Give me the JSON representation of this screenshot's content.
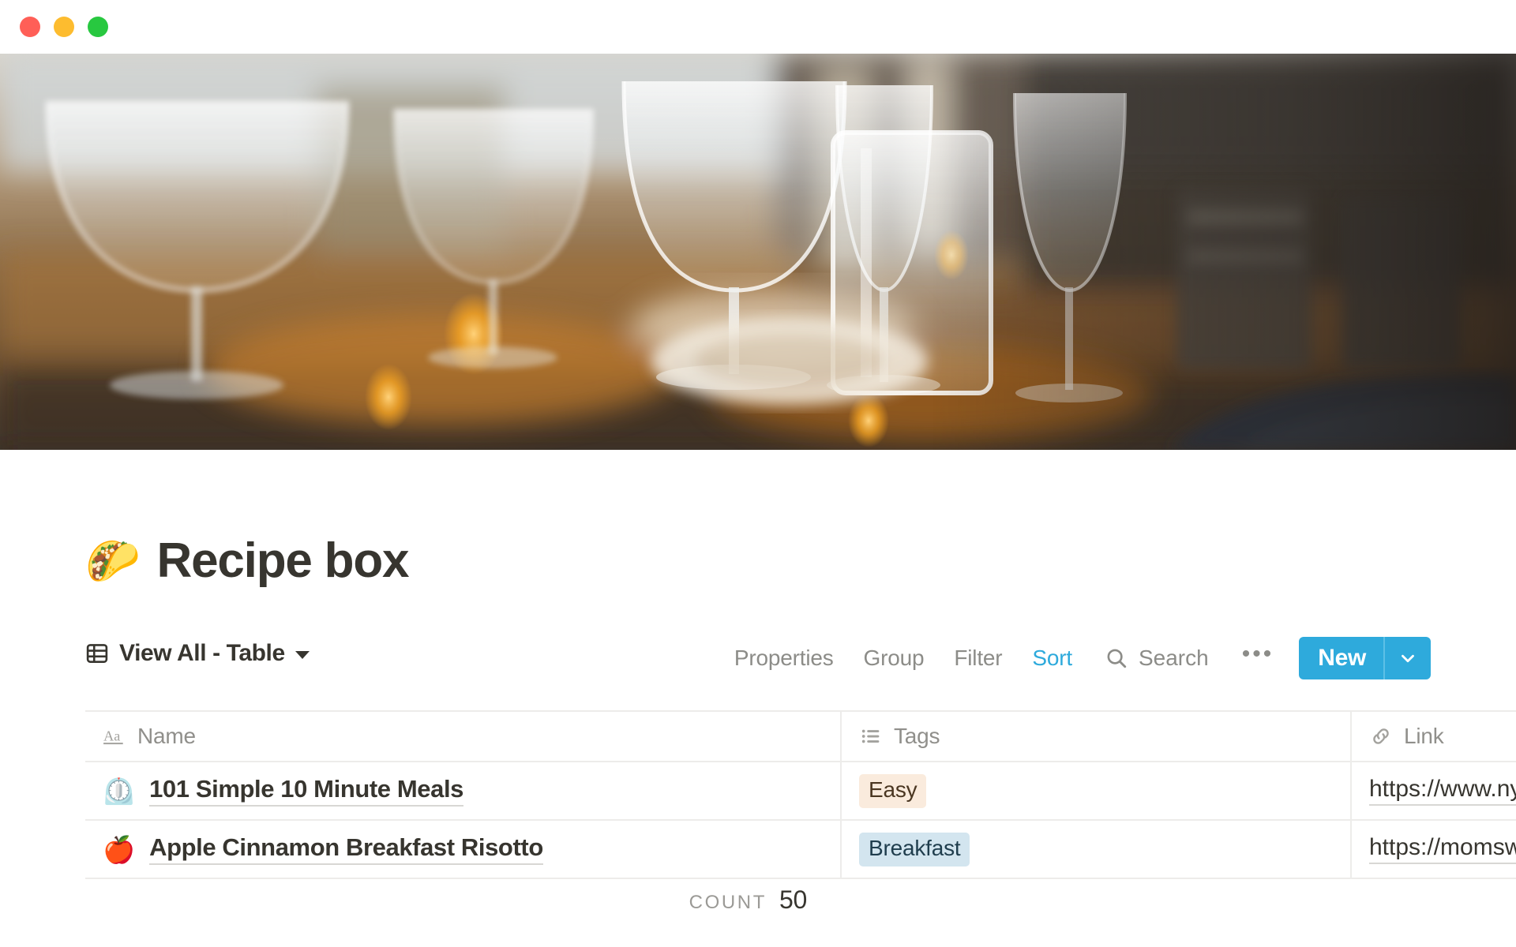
{
  "window": {
    "traffic_lights": [
      {
        "name": "close",
        "color": "#FF5F57"
      },
      {
        "name": "minimize",
        "color": "#FDBC2F"
      },
      {
        "name": "maximize",
        "color": "#28C840"
      }
    ]
  },
  "cover": {
    "alt": "Blurred restaurant table setting with wine glasses",
    "icon": "cover-image"
  },
  "page": {
    "emoji": "🌮",
    "title": "Recipe box"
  },
  "toolbar": {
    "view_icon": "table-icon",
    "view_name": "View All - Table",
    "view_chevron": "chevron-down-icon",
    "buttons": [
      {
        "label": "Properties",
        "active": false
      },
      {
        "label": "Group",
        "active": false
      },
      {
        "label": "Filter",
        "active": false
      },
      {
        "label": "Sort",
        "active": true
      }
    ],
    "search_icon": "search-icon",
    "search_label": "Search",
    "overflow_label": "•••",
    "new_label": "New",
    "new_caret_icon": "chevron-down-icon",
    "accent_color": "#2EAADC"
  },
  "table": {
    "columns": [
      {
        "key": "name",
        "label": "Name",
        "icon": "title-text-icon"
      },
      {
        "key": "tags",
        "label": "Tags",
        "icon": "multi-select-list-icon"
      },
      {
        "key": "link",
        "label": "Link",
        "icon": "link-icon"
      }
    ],
    "rows": [
      {
        "emoji": "⏲️",
        "name": "101 Simple 10 Minute Meals",
        "tag": "Easy",
        "tag_bg": "#FAEBDD",
        "tag_fg": "#4A3621",
        "link": "https://www.ny"
      },
      {
        "emoji": "🍎",
        "name": "Apple Cinnamon Breakfast Risotto",
        "tag": "Breakfast",
        "tag_bg": "#D3E5EF",
        "tag_fg": "#1F3D4D",
        "link": "https://momsw"
      }
    ]
  },
  "footer": {
    "count_label": "Count",
    "count_value": "50"
  }
}
